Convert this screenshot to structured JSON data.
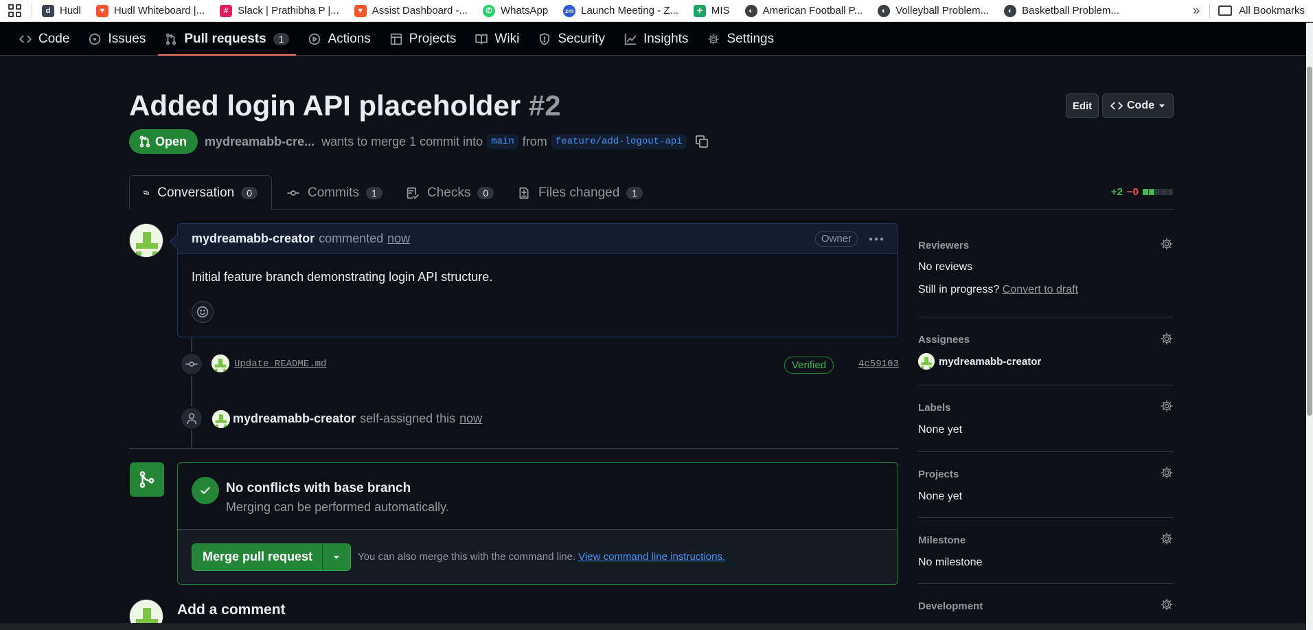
{
  "bookmarks": {
    "items": [
      {
        "label": "Hudl",
        "icon": "hudl-icon",
        "color": "#3b4252"
      },
      {
        "label": "Hudl Whiteboard |...",
        "icon": "brave-lion-icon",
        "color": "#fb542b"
      },
      {
        "label": "Slack | Prathibha P |...",
        "icon": "slack-icon",
        "color": "#e01e5a"
      },
      {
        "label": "Assist Dashboard -...",
        "icon": "brave-lion-icon",
        "color": "#fb542b"
      },
      {
        "label": "WhatsApp",
        "icon": "whatsapp-icon",
        "color": "#25d366"
      },
      {
        "label": "Launch Meeting - Z...",
        "icon": "zoom-icon",
        "color": "#2d5bd7"
      },
      {
        "label": "MIS",
        "icon": "sheets-plus-icon",
        "color": "#1fa463"
      },
      {
        "label": "American Football P...",
        "icon": "globe-icon",
        "color": "#3c4043"
      },
      {
        "label": "Volleyball Problem...",
        "icon": "globe-icon",
        "color": "#3c4043"
      },
      {
        "label": "Basketball Problem...",
        "icon": "globe-icon",
        "color": "#3c4043"
      }
    ],
    "more": "»",
    "all_bookmarks": "All Bookmarks"
  },
  "repo_nav": {
    "items": [
      {
        "label": "Code",
        "icon": "code-icon"
      },
      {
        "label": "Issues",
        "icon": "issue-opened-icon"
      },
      {
        "label": "Pull requests",
        "icon": "git-pull-request-icon",
        "count": "1",
        "active": true
      },
      {
        "label": "Actions",
        "icon": "play-icon"
      },
      {
        "label": "Projects",
        "icon": "table-icon"
      },
      {
        "label": "Wiki",
        "icon": "book-icon"
      },
      {
        "label": "Security",
        "icon": "shield-icon"
      },
      {
        "label": "Insights",
        "icon": "graph-icon"
      },
      {
        "label": "Settings",
        "icon": "gear-icon"
      }
    ]
  },
  "pr": {
    "title": "Added login API placeholder",
    "number": "#2",
    "edit_label": "Edit",
    "code_label": "Code",
    "state": "Open",
    "author_short": "mydreamabb-cre...",
    "merge_text_1": "wants to merge 1 commit into",
    "base_branch": "main",
    "from_text": "from",
    "head_branch": "feature/add-logout-api"
  },
  "tabs": [
    {
      "label": "Conversation",
      "count": "0",
      "icon": "comment-discussion-icon"
    },
    {
      "label": "Commits",
      "count": "1",
      "icon": "git-commit-icon"
    },
    {
      "label": "Checks",
      "count": "0",
      "icon": "checklist-icon"
    },
    {
      "label": "Files changed",
      "count": "1",
      "icon": "file-diff-icon"
    }
  ],
  "diffstat": {
    "additions": "+2",
    "deletions": "−0",
    "blocks": [
      "#3fb950",
      "#3fb950",
      "#30363d",
      "#30363d",
      "#30363d"
    ]
  },
  "comment": {
    "author": "mydreamabb-creator",
    "action": "commented",
    "time": "now",
    "role": "Owner",
    "body": "Initial feature branch demonstrating login API structure."
  },
  "commit_event": {
    "message": "Update README.md",
    "verified": "Verified",
    "sha": "4c59103"
  },
  "assign_event": {
    "actor": "mydreamabb-creator",
    "action": "self-assigned this",
    "time": "now"
  },
  "merge": {
    "title": "No conflicts with base branch",
    "subtitle": "Merging can be performed automatically.",
    "button": "Merge pull request",
    "hint": "You can also merge this with the command line.",
    "hint_link": "View command line instructions."
  },
  "add_comment": {
    "title": "Add a comment"
  },
  "sidebar": {
    "reviewers": {
      "heading": "Reviewers",
      "value": "No reviews",
      "progress_text": "Still in progress?",
      "draft_link": "Convert to draft"
    },
    "assignees": {
      "heading": "Assignees",
      "value": "mydreamabb-creator"
    },
    "labels": {
      "heading": "Labels",
      "value": "None yet"
    },
    "projects": {
      "heading": "Projects",
      "value": "None yet"
    },
    "milestone": {
      "heading": "Milestone",
      "value": "No milestone"
    },
    "development": {
      "heading": "Development"
    }
  },
  "colors": {
    "accent_green": "#238636",
    "link_blue": "#4493f8",
    "nav_underline": "#f78166",
    "background": "#0d1117"
  }
}
